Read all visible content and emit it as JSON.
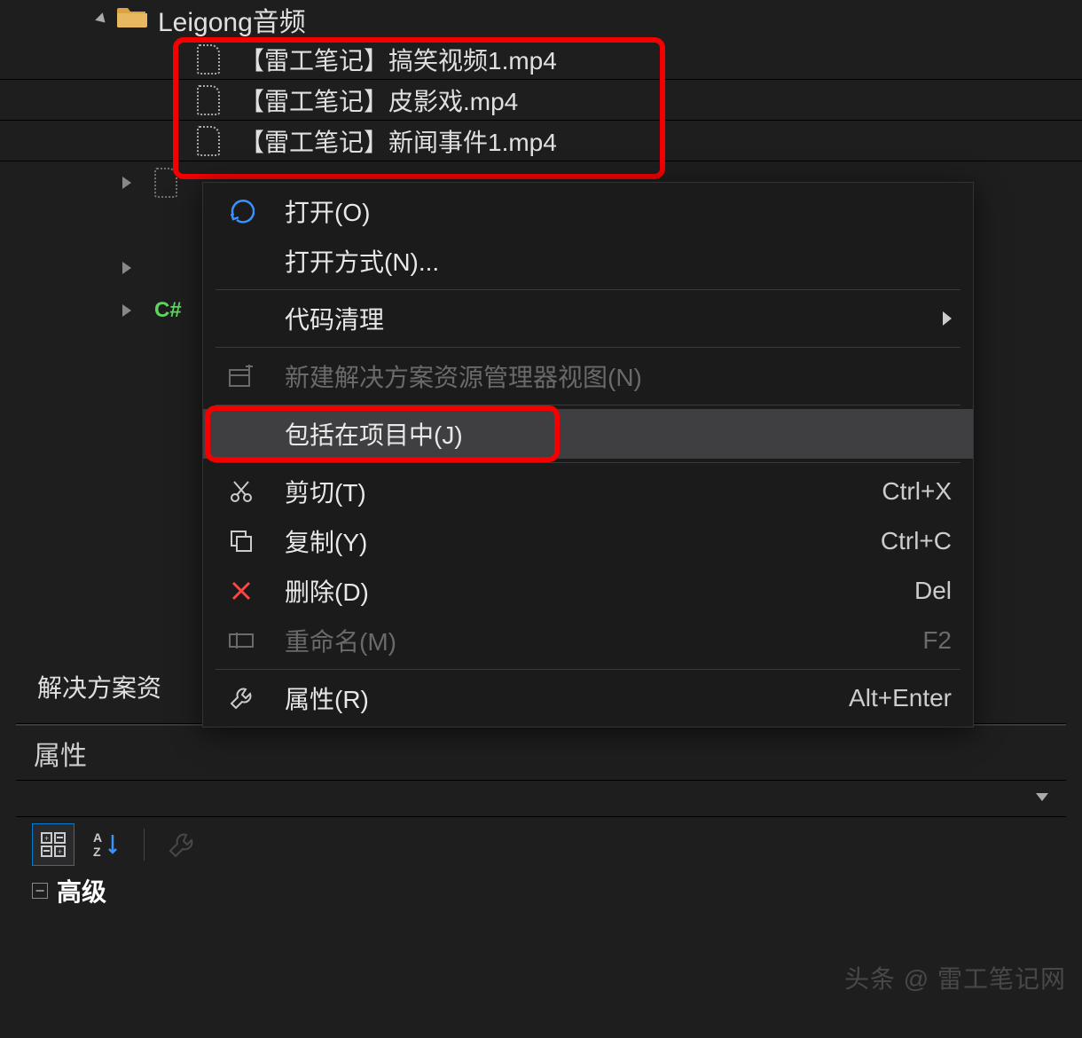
{
  "tree": {
    "folder_name": "Leigong音频",
    "files": [
      "【雷工笔记】搞笑视频1.mp4",
      "【雷工笔记】皮影戏.mp4",
      "【雷工笔记】新闻事件1.mp4"
    ],
    "cs_label": "C#"
  },
  "context_menu": {
    "open": "打开(O)",
    "open_with": "打开方式(N)...",
    "code_cleanup": "代码清理",
    "new_view": "新建解决方案资源管理器视图(N)",
    "include_in_project": "包括在项目中(J)",
    "cut": {
      "label": "剪切(T)",
      "shortcut": "Ctrl+X"
    },
    "copy": {
      "label": "复制(Y)",
      "shortcut": "Ctrl+C"
    },
    "delete": {
      "label": "删除(D)",
      "shortcut": "Del"
    },
    "rename": {
      "label": "重命名(M)",
      "shortcut": "F2"
    },
    "properties": {
      "label": "属性(R)",
      "shortcut": "Alt+Enter"
    }
  },
  "panels": {
    "solution_explorer_truncated": "解决方案资",
    "properties_title": "属性",
    "advanced_category": "高级"
  },
  "watermark": "头条 @ 雷工笔记网"
}
